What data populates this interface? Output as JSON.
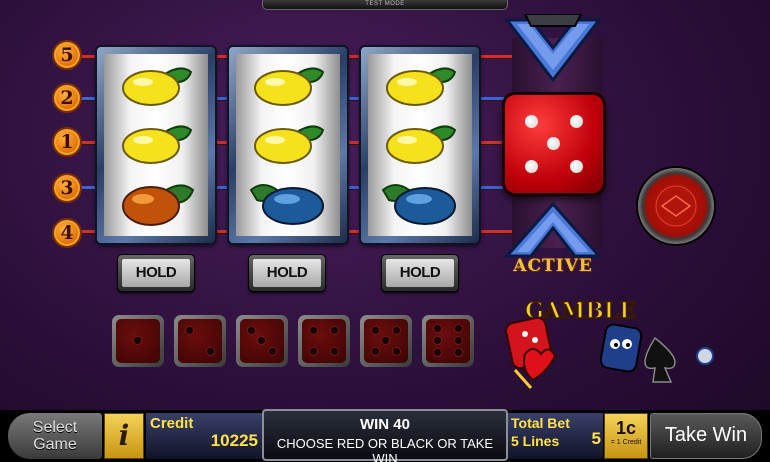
{
  "header": {
    "mode_label": "TEST MODE"
  },
  "paylines": {
    "markers": [
      "5",
      "2",
      "1",
      "3",
      "4"
    ]
  },
  "reels": [
    {
      "symbols": [
        "lemon",
        "lemon",
        "orange"
      ]
    },
    {
      "symbols": [
        "lemon",
        "lemon",
        "plum"
      ]
    },
    {
      "symbols": [
        "lemon",
        "lemon",
        "plum"
      ]
    }
  ],
  "hold_buttons": [
    {
      "label": "HOLD"
    },
    {
      "label": "HOLD"
    },
    {
      "label": "HOLD"
    }
  ],
  "dice_history": [
    1,
    2,
    3,
    4,
    5,
    6
  ],
  "gamble": {
    "die_value": 5,
    "status_label": "ACTIVE",
    "logo_text": "GAMBLE",
    "colors": {
      "die": "#c0000a",
      "status": "#f0c040"
    }
  },
  "bottom_bar": {
    "select_game_label": "Select Game",
    "info_label": "i",
    "credit_label": "Credit",
    "credit_value": "10225",
    "win_label": "WIN 40",
    "message": "CHOOSE RED OR BLACK OR TAKE WIN",
    "total_bet_label": "Total Bet",
    "lines_label": "5 Lines",
    "bet_value": "5",
    "coin_value": "1c",
    "coin_sub": "= 1 Credit",
    "take_win_label": "Take Win"
  }
}
